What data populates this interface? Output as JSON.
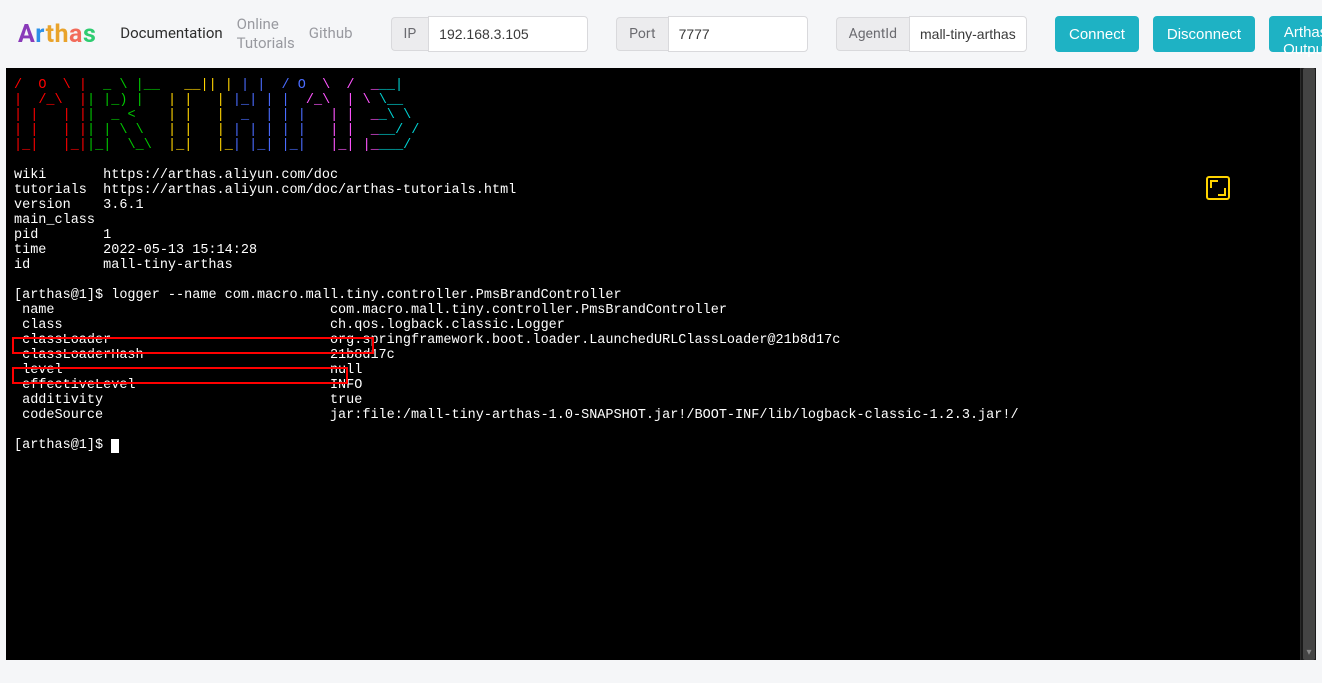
{
  "header": {
    "logo_text": "Arthas",
    "nav": {
      "documentation": "Documentation",
      "tutorials": "Online\nTutorials",
      "github": "Github"
    },
    "ip": {
      "label": "IP",
      "value": "192.168.3.105"
    },
    "port": {
      "label": "Port",
      "value": "7777"
    },
    "agent": {
      "label": "AgentId",
      "value": "mall-tiny-arthas"
    },
    "buttons": {
      "connect": "Connect",
      "disconnect": "Disconnect",
      "output": "Arthas Output"
    }
  },
  "terminal": {
    "ascii_art": [
      "/  O  \\ |  _ \\ |__   __|| | | |  / O  \\  /  ___|",
      "|  /_\\  || |_) |   | |   | |_| | |  /_\\  | \\ \\__  ",
      "| |   | ||  _ <    | |   |  _  | | |   | |  __\\ \\ ",
      "| |   | || | \\ \\   | |   | | | | | |   | |  ___/ / ",
      "|_|   |_||_|  \\_\\  |_|   |_| |_| |_|   |_| |____/ "
    ],
    "info_rows": [
      [
        "wiki",
        "https://arthas.aliyun.com/doc"
      ],
      [
        "tutorials",
        "https://arthas.aliyun.com/doc/arthas-tutorials.html"
      ],
      [
        "version",
        "3.6.1"
      ],
      [
        "main_class",
        ""
      ],
      [
        "pid",
        "1"
      ],
      [
        "time",
        "2022-05-13 15:14:28"
      ],
      [
        "id",
        "mall-tiny-arthas"
      ]
    ],
    "prompt1": "[arthas@1]$",
    "command1": "logger --name com.macro.mall.tiny.controller.PmsBrandController",
    "logger_rows": [
      [
        "name",
        "com.macro.mall.tiny.controller.PmsBrandController"
      ],
      [
        "class",
        "ch.qos.logback.classic.Logger"
      ],
      [
        "classLoader",
        "org.springframework.boot.loader.LaunchedURLClassLoader@21b8d17c"
      ],
      [
        "classLoaderHash",
        "21b8d17c"
      ],
      [
        "level",
        "null"
      ],
      [
        "effectiveLevel",
        "INFO"
      ],
      [
        "additivity",
        "true"
      ],
      [
        "codeSource",
        "jar:file:/mall-tiny-arthas-1.0-SNAPSHOT.jar!/BOOT-INF/lib/logback-classic-1.2.3.jar!/"
      ]
    ],
    "prompt2": "[arthas@1]$"
  },
  "highlights": [
    {
      "row_index": 3,
      "label": "classLoaderHash",
      "value": "21b8d17c"
    },
    {
      "row_index": 5,
      "label": "effectiveLevel",
      "value": "INFO"
    }
  ]
}
